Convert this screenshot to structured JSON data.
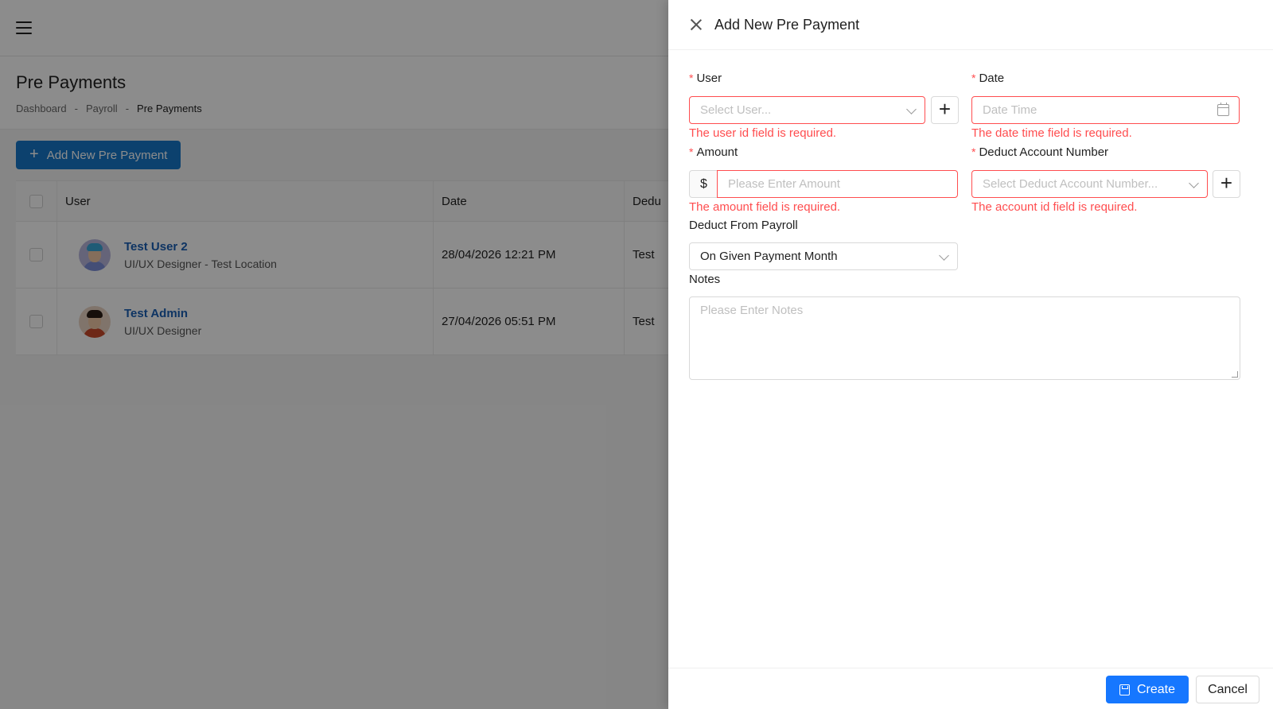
{
  "page": {
    "title": "Pre Payments",
    "breadcrumb": [
      "Dashboard",
      "Payroll",
      "Pre Payments"
    ],
    "breadcrumb_sep": "-",
    "add_button": "Add New Pre Payment",
    "table": {
      "columns": [
        "User",
        "Date",
        "Dedu"
      ],
      "rows": [
        {
          "name": "Test User 2",
          "role": "UI/UX Designer - Test Location",
          "date": "28/04/2026 12:21 PM",
          "deduct": "Test"
        },
        {
          "name": "Test Admin",
          "role": "UI/UX Designer",
          "date": "27/04/2026 05:51 PM",
          "deduct": "Test"
        }
      ]
    }
  },
  "drawer": {
    "title": "Add New Pre Payment",
    "user": {
      "label": "User",
      "placeholder": "Select User...",
      "error": "The user id field is required."
    },
    "date": {
      "label": "Date",
      "placeholder": "Date Time",
      "error": "The date time field is required."
    },
    "amount": {
      "label": "Amount",
      "prefix": "$",
      "placeholder": "Please Enter Amount",
      "error": "The amount field is required."
    },
    "account": {
      "label": "Deduct Account Number",
      "placeholder": "Select Deduct Account Number...",
      "error": "The account id field is required."
    },
    "payroll": {
      "label": "Deduct From Payroll",
      "value": "On Given Payment Month"
    },
    "notes": {
      "label": "Notes",
      "placeholder": "Please Enter Notes"
    },
    "create": "Create",
    "cancel": "Cancel",
    "required_mark": "*"
  },
  "colors": {
    "primary": "#1677ff",
    "error": "#ff4d4f",
    "link": "#1a5fb4"
  },
  "icons": [
    "menu-icon",
    "plus-icon",
    "close-icon",
    "chevron-down-icon",
    "calendar-icon",
    "save-icon"
  ]
}
